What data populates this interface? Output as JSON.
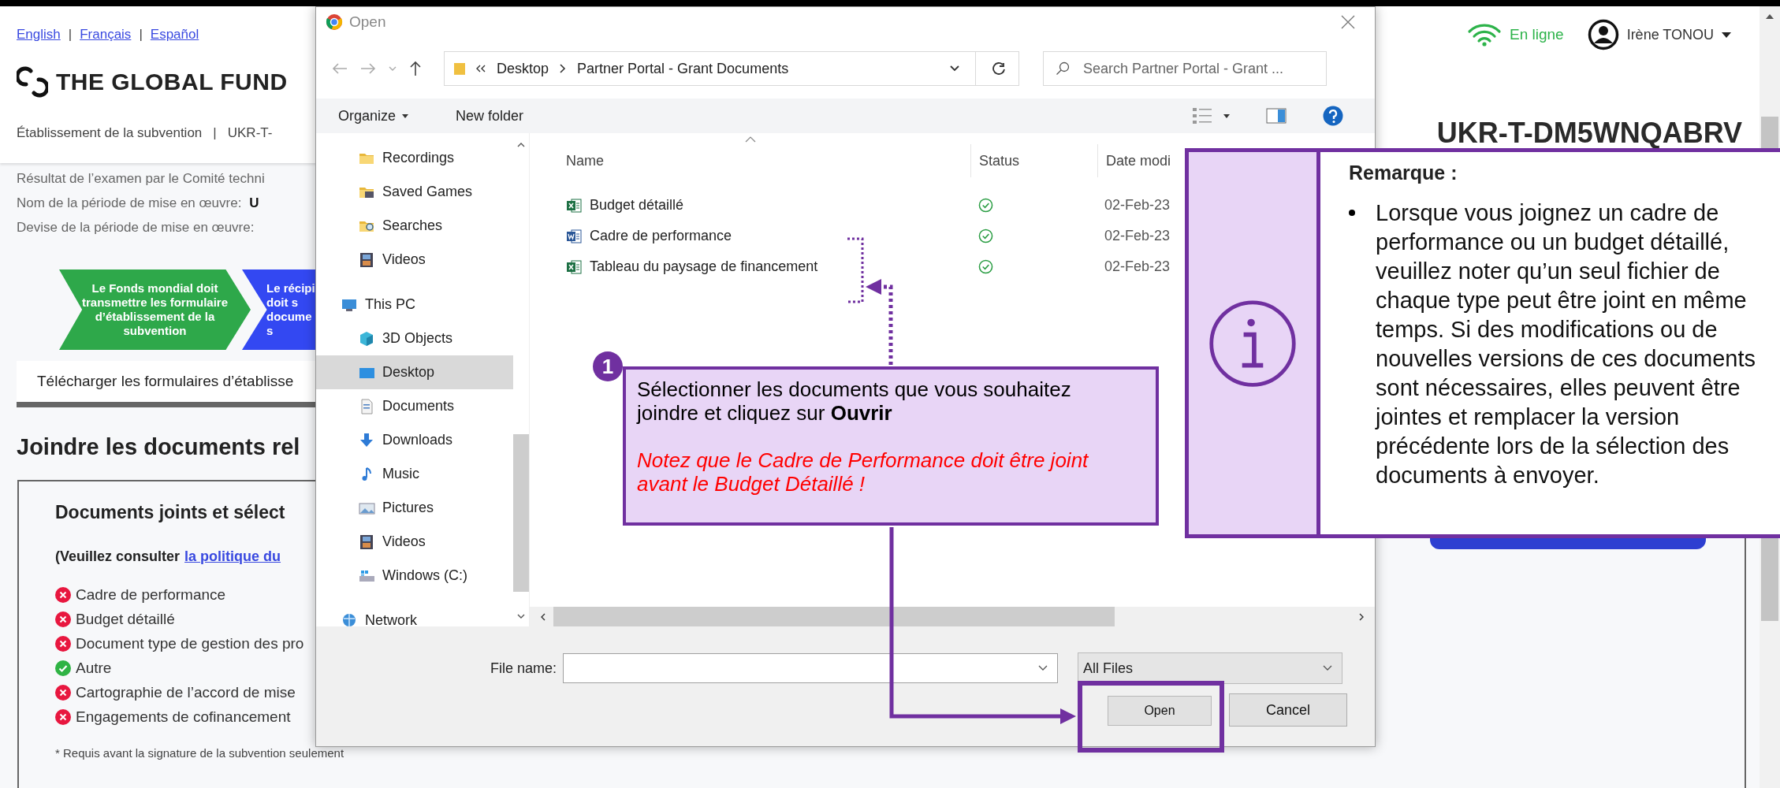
{
  "page": {
    "languages": [
      "English",
      "Français",
      "Español"
    ],
    "language_separator": "|",
    "logo_text": "THE GLOBAL FUND",
    "breadcrumb": [
      "Établissement de la subvention",
      "UKR-T-"
    ],
    "breadcrumb_separator": "|",
    "status": "En ligne",
    "user": "Irène TONOU",
    "grant_id": "UKR-T-DM5WNQABRV",
    "info_lines": [
      {
        "label": "Résultat de l’examen par le Comité techni"
      },
      {
        "label": "Nom de la période de mise en œuvre:",
        "value": "U"
      },
      {
        "label": "Devise de la période de mise en œuvre:"
      }
    ],
    "process_steps": [
      {
        "lines": [
          "Le Fonds mondial doit",
          "transmettre les formulaire",
          "d’établissement de la",
          "subvention"
        ],
        "color": "#2ea84a"
      },
      {
        "lines": [
          "Le récipi",
          "doit s",
          "docume",
          "s"
        ],
        "color": "#3348f2"
      }
    ],
    "download_tab": "Télécharger les formulaires d’établisse",
    "section_title": "Joindre les documents rel",
    "documents_panel": {
      "title": "Documents joints et sélect",
      "note": "(Veuillez consulter",
      "note_link": "la politique du",
      "items": [
        {
          "label": "Cadre de performance",
          "attached": false
        },
        {
          "label": "Budget détaillé",
          "attached": false
        },
        {
          "label": "Document type de gestion des pro",
          "attached": false
        },
        {
          "label": "Autre",
          "attached": true
        },
        {
          "label": "Cartographie de l’accord de mise",
          "attached": false
        },
        {
          "label": "Engagements de cofinancement",
          "attached": false
        }
      ],
      "footnote": "* Requis avant la signature de la subvention seulement"
    }
  },
  "dialog": {
    "title": "Open",
    "path": [
      "Desktop",
      "Partner Portal - Grant Documents"
    ],
    "search_placeholder": "Search Partner Portal - Grant ...",
    "toolbar": [
      {
        "label": "Organize",
        "menu": true
      },
      {
        "label": "New folder",
        "menu": false
      }
    ],
    "nav": [
      {
        "children": [
          {
            "label": "Recordings",
            "kind": "folder",
            "selected": false
          },
          {
            "label": "Saved Games",
            "kind": "games",
            "selected": false
          },
          {
            "label": "Searches",
            "kind": "searches",
            "selected": false
          },
          {
            "label": "Videos",
            "kind": "videos",
            "selected": false
          }
        ]
      },
      {
        "label": "This PC",
        "kind": "pc",
        "selected": false,
        "children": [
          {
            "label": "3D Objects",
            "kind": "objects",
            "selected": false
          },
          {
            "label": "Desktop",
            "kind": "desktop",
            "selected": true
          },
          {
            "label": "Documents",
            "kind": "documents",
            "selected": false
          },
          {
            "label": "Downloads",
            "kind": "downloads",
            "selected": false
          },
          {
            "label": "Music",
            "kind": "music",
            "selected": false
          },
          {
            "label": "Pictures",
            "kind": "pictures",
            "selected": false
          },
          {
            "label": "Videos",
            "kind": "videos",
            "selected": false
          },
          {
            "label": "Windows (C:)",
            "kind": "drive",
            "selected": false
          }
        ]
      },
      {
        "label": "Network",
        "kind": "network",
        "selected": false
      }
    ],
    "columns": [
      "Name",
      "Status",
      "Date modi"
    ],
    "files": [
      {
        "name": "Budget détaillé",
        "kind": "spreadsheet",
        "date": "02-Feb-23"
      },
      {
        "name": "Cadre de performance",
        "kind": "document",
        "date": "02-Feb-23"
      },
      {
        "name": "Tableau du paysage de financement",
        "kind": "spreadsheet",
        "date": "02-Feb-23"
      }
    ],
    "file_name_label": "File name:",
    "file_type": "All Files",
    "buttons": [
      "Open",
      "Cancel"
    ]
  },
  "callout": {
    "number": "1",
    "text": "Sélectionner les documents que vous souhaitez joindre et cliquez sur **Ouvrir**",
    "note": "Notez que le Cadre de Performance doit être joint avant le Budget Détaillé !"
  },
  "remark": {
    "title": "Remarque :",
    "text": "Lorsque vous joignez un cadre de performance ou un budget détaillé, veuillez noter qu’un seul fichier de chaque type peut être joint en même temps. Si des modifications ou de nouvelles versions de ces documents sont nécessaires, elles peuvent être jointes et remplacer la version précédente lors de la sélection des documents à envoyer."
  }
}
